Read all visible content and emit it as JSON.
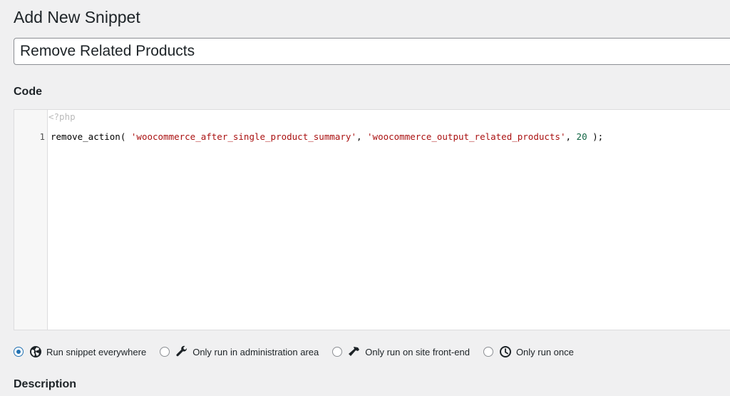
{
  "page": {
    "title": "Add New Snippet"
  },
  "snippet": {
    "title_value": "Remove Related Products",
    "code_label": "Code",
    "description_label": "Description"
  },
  "editor": {
    "php_open": "<?php",
    "line_number": "1",
    "code_tokens": {
      "fn": "remove_action( ",
      "arg1": "'woocommerce_after_single_product_summary'",
      "sep1": ", ",
      "arg2": "'woocommerce_output_related_products'",
      "sep2": ", ",
      "arg3": "20",
      "end": " );"
    }
  },
  "scope_options": [
    {
      "label": "Run snippet everywhere",
      "icon": "globe-icon",
      "checked": true
    },
    {
      "label": "Only run in administration area",
      "icon": "wrench-icon",
      "checked": false
    },
    {
      "label": "Only run on site front-end",
      "icon": "hammer-icon",
      "checked": false
    },
    {
      "label": "Only run once",
      "icon": "clock-icon",
      "checked": false
    }
  ],
  "colors": {
    "accent": "#2271b1",
    "string": "#aa1111",
    "number": "#116644"
  }
}
